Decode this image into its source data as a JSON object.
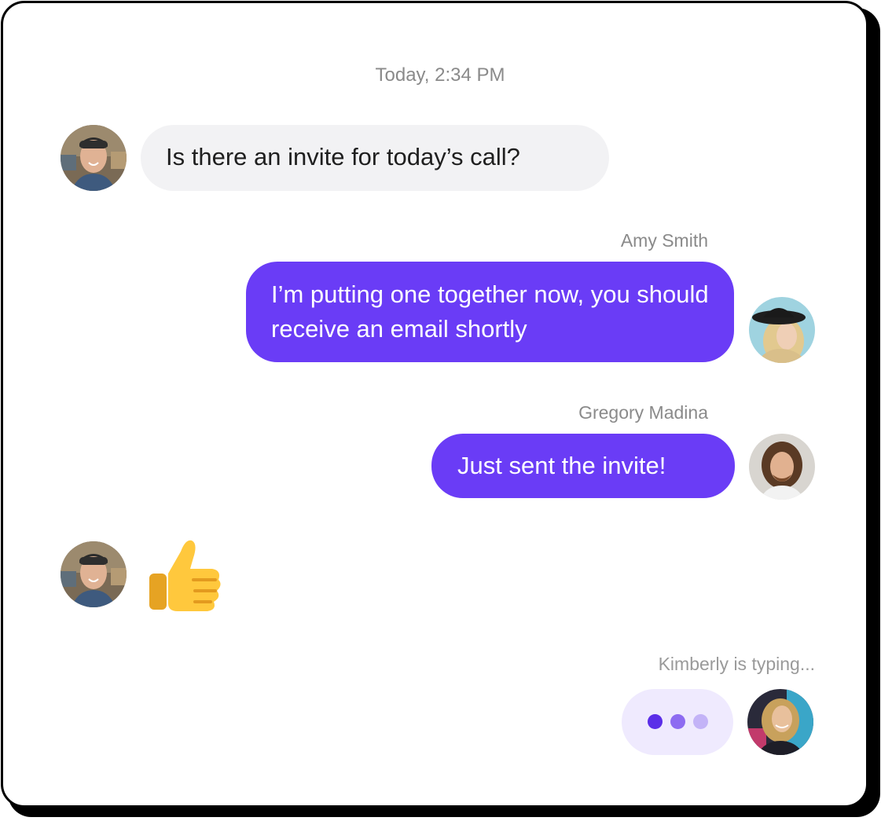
{
  "chat": {
    "timestamp": "Today, 2:34 PM",
    "messages": [
      {
        "sender": "",
        "direction": "incoming",
        "text": "Is there an invite for today’s call?"
      },
      {
        "sender": "Amy Smith",
        "direction": "outgoing",
        "text": "I’m putting one together now, you should receive an email shortly"
      },
      {
        "sender": "Gregory Madina",
        "direction": "outgoing",
        "text": "Just sent the invite!"
      },
      {
        "sender": "",
        "direction": "incoming",
        "text": "👍"
      }
    ],
    "typing_indicator": "Kimberly is typing..."
  },
  "colors": {
    "outgoing_bubble": "#6a3cf6",
    "incoming_bubble": "#f2f2f4",
    "typing_bubble": "#efeafe",
    "muted_text": "#8a8a8a",
    "typing_dots": [
      "#5b2ee8",
      "#8d6bf1",
      "#c3b3f7"
    ]
  },
  "icons": [
    "thumbs-up-emoji",
    "typing-dots-icon"
  ]
}
